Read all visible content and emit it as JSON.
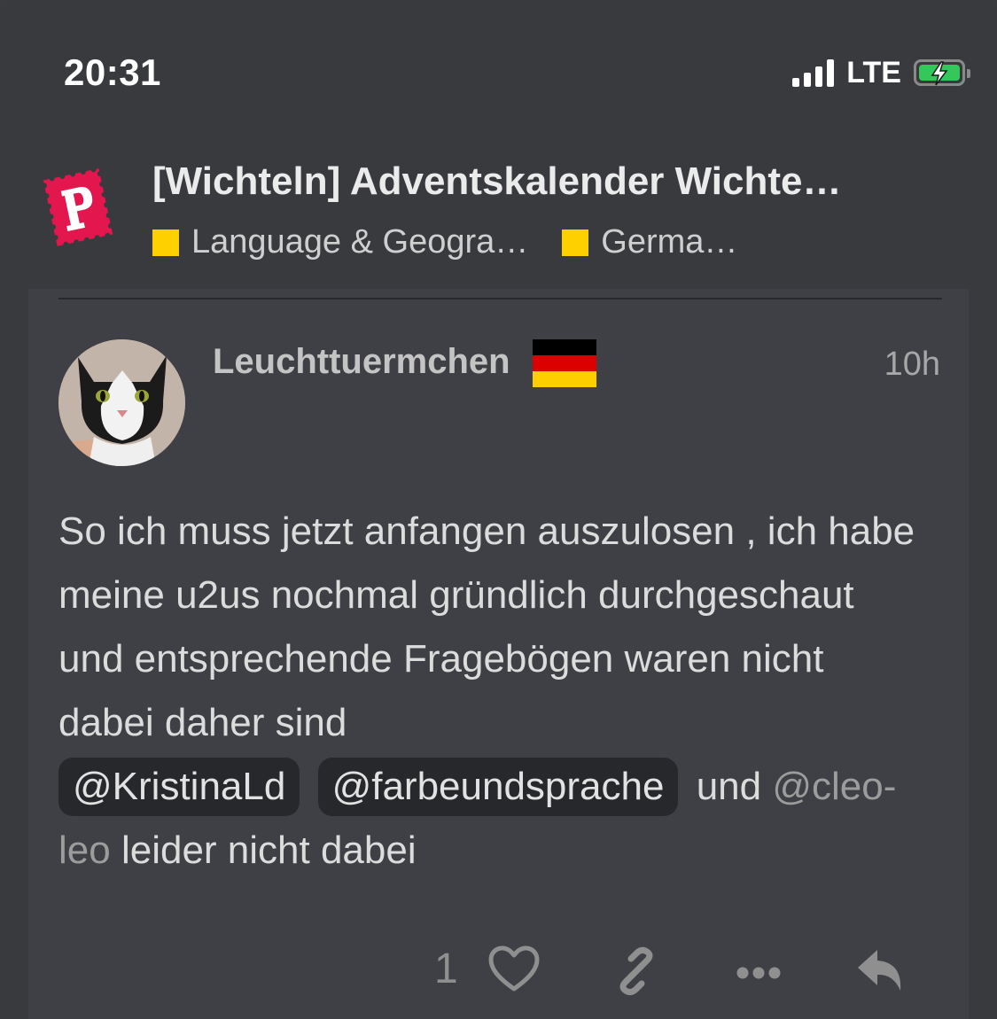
{
  "status_bar": {
    "time": "20:31",
    "network": "LTE",
    "battery_level": 1.0,
    "battery_color": "#34c759"
  },
  "header": {
    "logo_icon": "p-stamp-logo",
    "logo_color": "#e3174e",
    "title": "[Wichteln] Adventskalender Wichte…",
    "categories": [
      {
        "label": "Language & Geogra…",
        "color": "#ffd000"
      },
      {
        "label": "Germa…",
        "color": "#ffd000"
      }
    ]
  },
  "post": {
    "username": "Leuchttuermchen",
    "flag_icon": "germany-flag-icon",
    "time_ago": "10h",
    "body": {
      "text_1": "So ich muss jetzt anfangen auszulosen , ich habe meine u2us nochmal gründlich durchgeschaut und entsprechende Fragebögen waren nicht dabei daher sind",
      "mention_1": "@KristinaLd",
      "mention_2": "@farbeundsprache",
      "text_2": "und",
      "mention_3": "@cleo-leo",
      "text_3": "leider nicht dabei"
    },
    "actions": {
      "like_count": "1",
      "like_icon": "heart-icon",
      "link_icon": "link-icon",
      "more_icon": "more-icon",
      "reply_icon": "reply-icon"
    }
  }
}
